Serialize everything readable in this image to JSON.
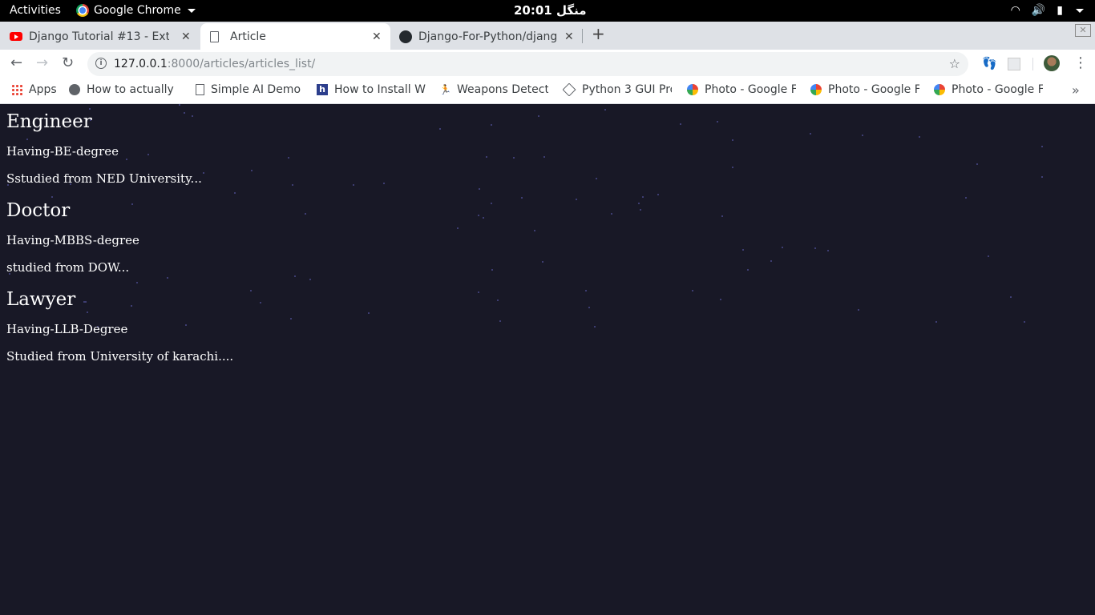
{
  "topbar": {
    "activities": "Activities",
    "app_name": "Google Chrome",
    "clock": "منگل 20:01"
  },
  "tabs": [
    {
      "title": "Django Tutorial #13 - Exte",
      "icon": "youtube-icon",
      "active": false
    },
    {
      "title": "Article",
      "icon": "document-icon",
      "active": true
    },
    {
      "title": "Django-For-Python/djang",
      "icon": "github-icon",
      "active": false
    }
  ],
  "toolbar": {
    "url_host": "127.0.0.1",
    "url_path": ":8000/articles/articles_list/"
  },
  "bookmarks": [
    {
      "label": "Apps",
      "icon": "apps-grid-icon"
    },
    {
      "label": "How to actually",
      "icon": "site-icon"
    },
    {
      "label": "Simple AI Demo",
      "icon": "page-icon"
    },
    {
      "label": "How to Install W",
      "icon": "h-icon"
    },
    {
      "label": "Weapons Detect",
      "icon": "figure-icon"
    },
    {
      "label": "Python 3 GUI Pro",
      "icon": "diamond-icon"
    },
    {
      "label": "Photo - Google F",
      "icon": "google-photos-icon"
    },
    {
      "label": "Photo - Google F",
      "icon": "google-photos-icon"
    },
    {
      "label": "Photo - Google F",
      "icon": "google-photos-icon"
    }
  ],
  "articles": [
    {
      "title": "Engineer",
      "slug": "Having-BE-degree",
      "snippet": "Sstudied from NED University..."
    },
    {
      "title": "Doctor",
      "slug": "Having-MBBS-degree",
      "snippet": "studied from DOW..."
    },
    {
      "title": "Lawyer",
      "slug": "Having-LLB-Degree",
      "snippet": "Studied from University of karachi...."
    }
  ],
  "colors": {
    "page_background": "#181826",
    "page_text": "#ffffff",
    "tab_strip": "#dee1e6"
  }
}
